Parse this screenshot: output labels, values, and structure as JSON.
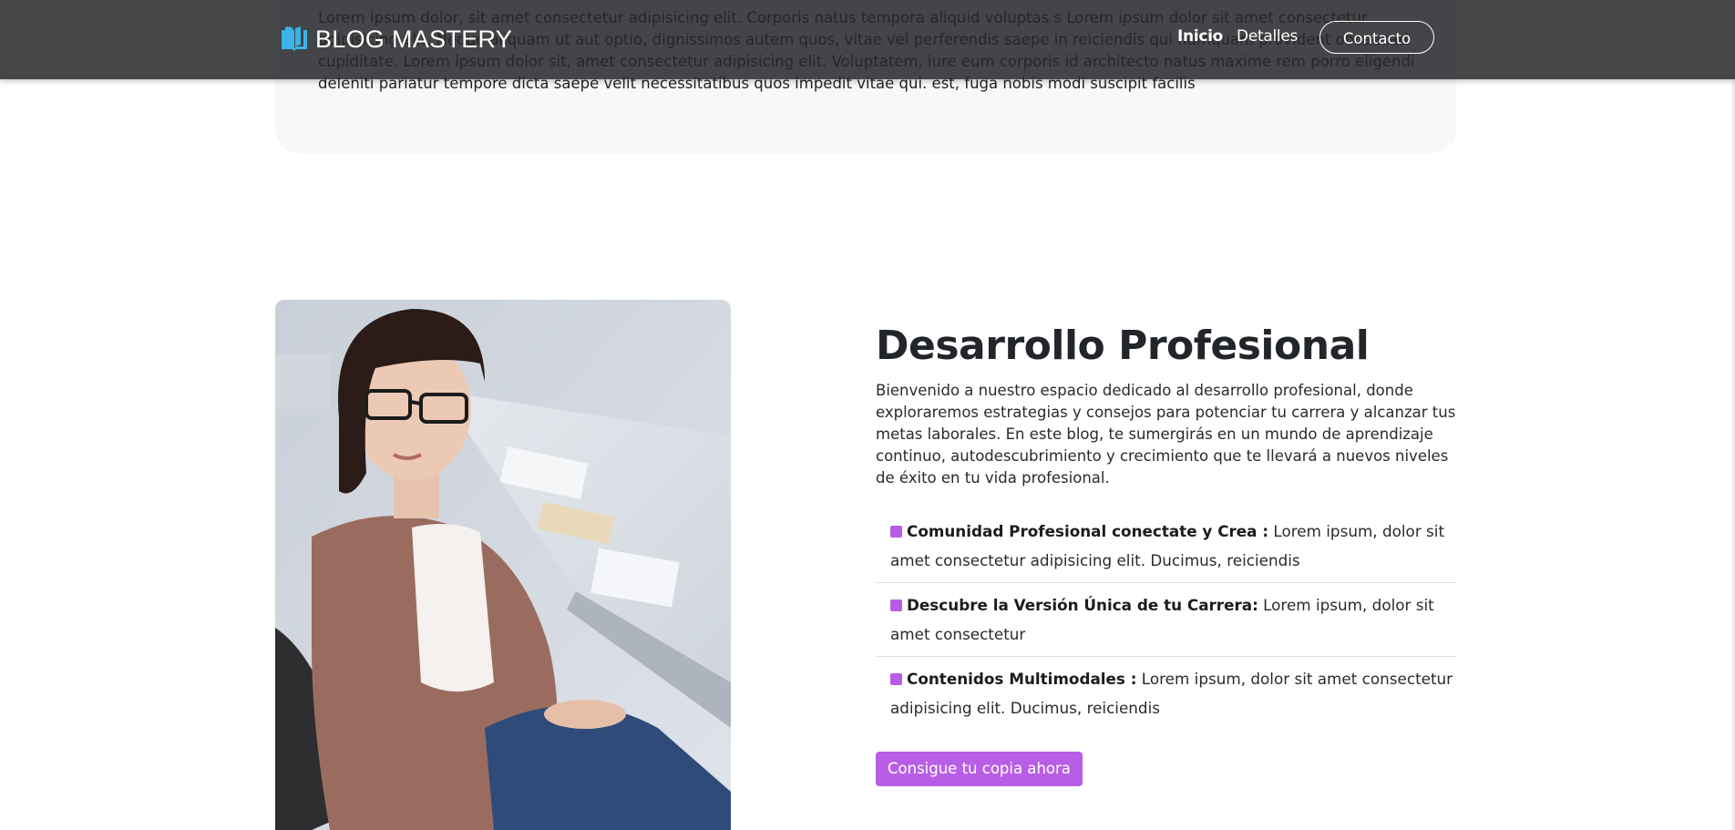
{
  "top_card": {
    "text": "Lorem ipsum dolor, sit amet consectetur adipisicing elit. Corporis natus tempora aliquid voluptas s Lorem ipsum dolor sit amet consectetur adipisicing elit. Neque aliquam ut aut optio, dignissimos autem quos, vitae vel perferendis saepe in reiciendis qui numquam provident obcaecati cupiditate. Lorem ipsum dolor sit, amet consectetur adipisicing elit. Voluptatem, iure eum corporis id architecto natus maxime rem porro eligendi deleniti pariatur tempore dicta saepe velit necessitatibus quos impedit vitae qui. est, fuga nobis modi suscipit facilis"
  },
  "navbar": {
    "brand": "BLOG MASTERY",
    "links": [
      {
        "label": "Inicio"
      },
      {
        "label": "Detalles"
      }
    ],
    "contact_label": "Contacto"
  },
  "section": {
    "heading": "Desarrollo Profesional",
    "intro": "Bienvenido a nuestro espacio dedicado al desarrollo profesional, donde exploraremos estrategias y consejos para potenciar tu carrera y alcanzar tus metas laborales. En este blog, te sumergirás en un mundo de aprendizaje continuo, autodescubrimiento y crecimiento que te llevará a nuevos niveles de éxito en tu vida profesional.",
    "features": [
      {
        "title": "Comunidad Profesional conectate y Crea :",
        "text": " Lorem ipsum, dolor sit amet consectetur adipisicing elit. Ducimus, reiciendis"
      },
      {
        "title": "Descubre la Versión Única de tu Carrera:",
        "text": " Lorem ipsum, dolor sit amet consectetur"
      },
      {
        "title": "Contenidos Multimodales :",
        "text": " Lorem ipsum, dolor sit amet consectetur adipisicing elit. Ducimus, reiciendis"
      }
    ],
    "cta_label": "Consigue tu copia ahora"
  },
  "colors": {
    "accent": "#b85ee6",
    "brand_icon": "#3ab4e6",
    "navbar_bg": "#26282a"
  }
}
